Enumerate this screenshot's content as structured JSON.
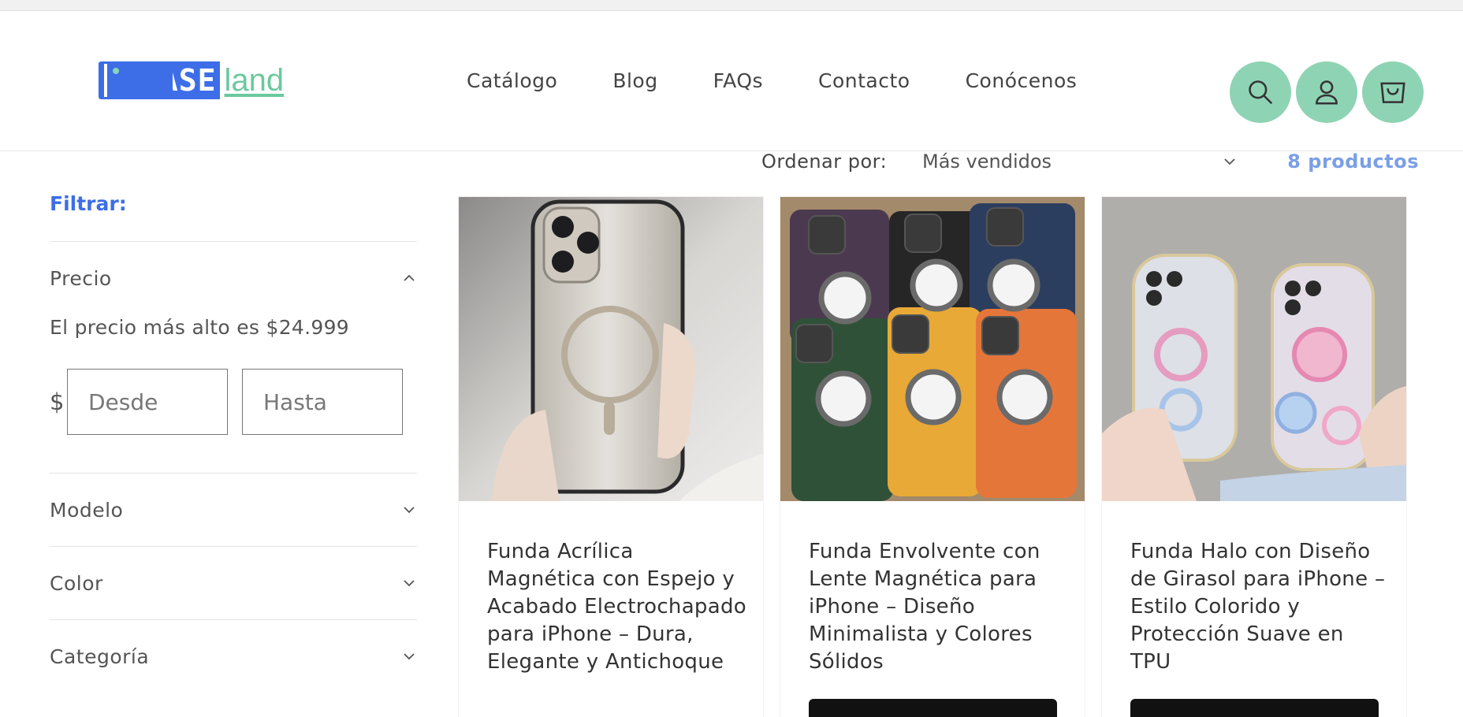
{
  "brand": {
    "logo_case": "CASE",
    "logo_land": "land"
  },
  "nav": [
    "Catálogo",
    "Blog",
    "FAQs",
    "Contacto",
    "Conócenos"
  ],
  "header_icons": [
    "search-icon",
    "account-icon",
    "cart-icon"
  ],
  "colors": {
    "accent": "#3d6ee8",
    "mint": "#8fd3b5",
    "count": "#7b9fe6"
  },
  "sort": {
    "label": "Ordenar por:",
    "value": "Más vendidos",
    "count": "8 productos"
  },
  "filters": {
    "heading": "Filtrar:",
    "price": {
      "label": "Precio",
      "note": "El precio más alto es $24.999",
      "currency": "$",
      "from_placeholder": "Desde",
      "to_placeholder": "Hasta"
    },
    "facets": [
      "Modelo",
      "Color",
      "Categoría"
    ]
  },
  "products": [
    {
      "title": "Funda Acrílica Magnética con Espejo y Acabado Electrochapado para iPhone – Dura, Elegante y Antichoque"
    },
    {
      "title": "Funda Envolvente con Lente Magnética para iPhone – Diseño Minimalista y Colores Sólidos"
    },
    {
      "title": "Funda Halo con Diseño de Girasol para iPhone – Estilo Colorido y Protección Suave en TPU"
    }
  ]
}
